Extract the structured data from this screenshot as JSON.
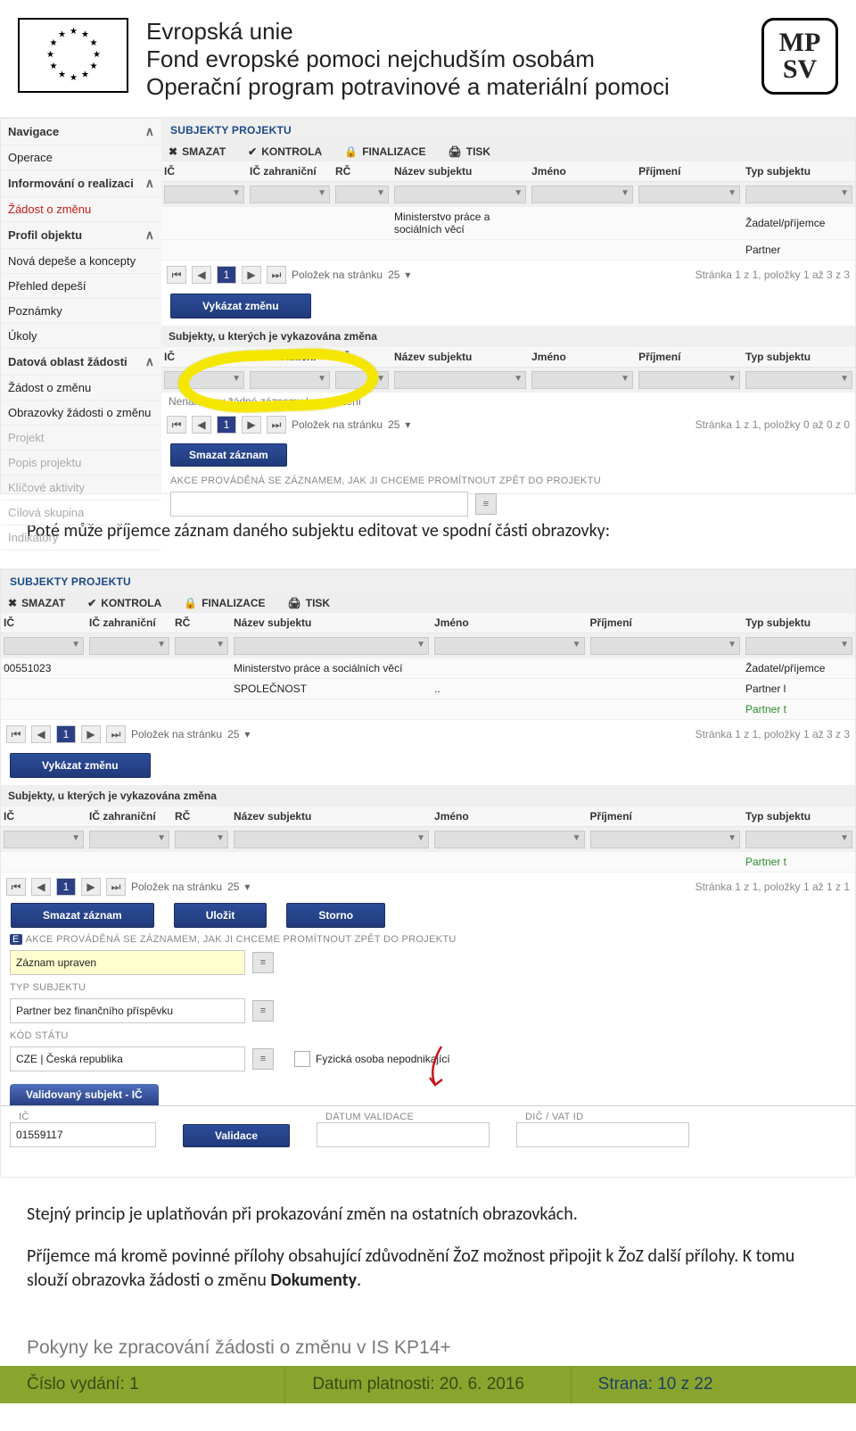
{
  "header": {
    "line1": "Evropská unie",
    "line2": "Fond evropské pomoci nejchudším osobám",
    "line3": "Operační program potravinové a materiální pomoci",
    "mpsv": "MP\nSV"
  },
  "sidebar": {
    "items": [
      {
        "label": "Navigace",
        "bold": true,
        "chev": true
      },
      {
        "label": "Operace"
      },
      {
        "label": "Informování o realizaci",
        "bold": true,
        "chev": true
      },
      {
        "label": "Žádost o změnu",
        "red": true
      },
      {
        "label": "Profil objektu",
        "bold": true,
        "chev": true
      },
      {
        "label": "Nová depeše a koncepty"
      },
      {
        "label": "Přehled depeší"
      },
      {
        "label": "Poznámky"
      },
      {
        "label": "Úkoly"
      },
      {
        "label": "Datová oblast žádosti",
        "bold": true,
        "chev": true
      },
      {
        "label": "Žádost o změnu"
      },
      {
        "label": "Obrazovky žádosti o změnu"
      },
      {
        "label": "Projekt",
        "dim": true
      },
      {
        "label": "Popis projektu",
        "dim": true
      },
      {
        "label": "Klíčové aktivity",
        "dim": true
      },
      {
        "label": "Cílová skupina",
        "dim": true
      },
      {
        "label": "Indikátory",
        "dim": true
      }
    ]
  },
  "shot1": {
    "title": "SUBJEKTY PROJEKTU",
    "toolbar": [
      "SMAZAT",
      "KONTROLA",
      "FINALIZACE",
      "TISK"
    ],
    "cols": [
      "IČ",
      "IČ zahraniční",
      "RČ",
      "Název subjektu",
      "Jméno",
      "Příjmení",
      "Typ subjektu"
    ],
    "rows": [
      {
        "ic": "",
        "nazev": "Ministerstvo práce a sociálních věcí",
        "typ": "Žadatel/příjemce"
      },
      {
        "ic": "",
        "nazev": "",
        "typ": "Partner"
      }
    ],
    "pager": {
      "label": "Položek na stránku",
      "size": "25",
      "info": "Stránka 1 z 1, položky 1 až 3 z 3"
    },
    "vykazat": "Vykázat změnu",
    "subheader": "Subjekty, u kterých je vykazována změna",
    "nofound": "Nenalezeny žádné záznamy k zobrazení",
    "pager2": {
      "info": "Stránka 1 z 1, položky 0 až 0 z 0"
    },
    "smazat": "Smazat záznam",
    "akce_label": "AKCE PROVÁDĚNÁ SE ZÁZNAMEM, JAK JI CHCEME PROMÍTNOUT ZPĚT DO PROJEKTU"
  },
  "para1": "Poté může příjemce záznam daného subjektu editovat ve spodní části obrazovky:",
  "shot2": {
    "title": "SUBJEKTY PROJEKTU",
    "toolbar": [
      "SMAZAT",
      "KONTROLA",
      "FINALIZACE",
      "TISK"
    ],
    "cols": [
      "IČ",
      "IČ zahraniční",
      "RČ",
      "Název subjektu",
      "Jméno",
      "Příjmení",
      "Typ subjektu"
    ],
    "rows1": [
      {
        "ic": "00551023",
        "nazev": "Ministerstvo práce a sociálních věcí",
        "typ": "Žadatel/příjemce"
      },
      {
        "ic": "",
        "nazev": "SPOLEČNOST",
        "jmeno": "..",
        "typ": "Partner l"
      },
      {
        "ic": "",
        "nazev": "",
        "typ": "Partner t",
        "green": true
      }
    ],
    "pager1_info": "Stránka 1 z 1, položky 1 až 3 z 3",
    "vykazat": "Vykázat změnu",
    "subheader": "Subjekty, u kterých je vykazována změna",
    "rows2": [
      {
        "typ": "Partner t",
        "green": true
      }
    ],
    "pager2_info": "Stránka 1 z 1, položky 1 až 1 z 1",
    "btn_smazat": "Smazat záznam",
    "btn_ulozit": "Uložit",
    "btn_storno": "Storno",
    "akce_label": "AKCE PROVÁDĚNÁ SE ZÁZNAMEM, JAK JI CHCEME PROMÍTNOUT ZPĚT DO PROJEKTU",
    "akce_value": "Záznam upraven",
    "typ_sub_label": "TYP SUBJEKTU",
    "typ_sub_value": "Partner bez finančního příspěvku",
    "kod_statu_label": "KÓD STÁTU",
    "kod_statu_value": "CZE | Česká republika",
    "fyz_osoba": "Fyzická osoba nepodnikající",
    "valid_tab": "Validovaný subjekt - IČ",
    "ic_label": "IČ",
    "ic_value": "01559117",
    "validace": "Validace",
    "datum_label": "DATUM VALIDACE",
    "dic_label": "DIČ / VAT ID",
    "polozek": "Položek na stránku",
    "polozek_n": "25"
  },
  "para2": "Stejný princip je uplatňován při prokazování změn na ostatních obrazovkách.",
  "para3": "Příjemce má kromě povinné přílohy obsahující zdůvodnění ŽoZ možnost připojit k ŽoZ další přílohy. K tomu slouží obrazovka žádosti o změnu ",
  "para3b": "Dokumenty",
  "para3c": ".",
  "footer": {
    "title": "Pokyny ke zpracování žádosti o změnu v IS KP14+",
    "c1_label": "Číslo vydání: ",
    "c1_val": "1",
    "c2_label": "Datum platnosti: ",
    "c2_val": "20. 6. 2016",
    "c3_label": "Strana: ",
    "c3_val": "10 z 22"
  }
}
